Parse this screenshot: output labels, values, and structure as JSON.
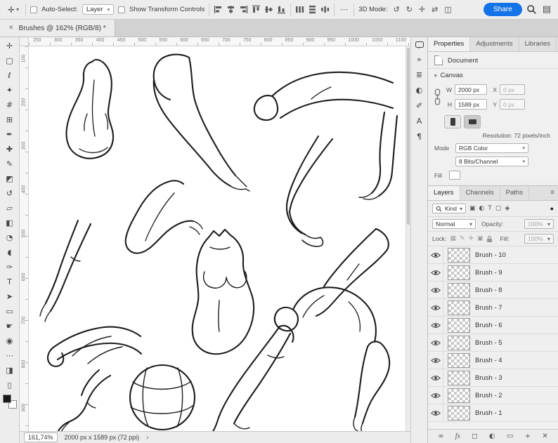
{
  "ui": {
    "chevron": "▾",
    "menu": "≡"
  },
  "topbar": {
    "tool_glyph": "✛",
    "auto_select_label": "Auto-Select:",
    "auto_select_value": "Layer",
    "transform_label": "Show Transform Controls",
    "more_glyph": "⋯",
    "threed_label": "3D Mode:",
    "threed_icons": [
      {
        "name": "3d-orbit-icon",
        "glyph": "↺"
      },
      {
        "name": "3d-roll-icon",
        "glyph": "↻"
      },
      {
        "name": "3d-drag-icon",
        "glyph": "✛"
      },
      {
        "name": "3d-slide-icon",
        "glyph": "⇄"
      },
      {
        "name": "3d-scale-icon",
        "glyph": "◫"
      }
    ],
    "share_label": "Share",
    "workspace_glyph": "▤"
  },
  "tab": {
    "close_glyph": "✕",
    "title": "Brushes @ 162% (RGB/8) *"
  },
  "tools": [
    {
      "name": "move-tool",
      "glyph": "✛"
    },
    {
      "name": "marquee-tool",
      "glyph": "▢"
    },
    {
      "name": "lasso-tool",
      "glyph": "ℓ"
    },
    {
      "name": "quick-selection-tool",
      "glyph": "✦"
    },
    {
      "name": "crop-tool",
      "glyph": "#"
    },
    {
      "name": "frame-tool",
      "glyph": "⊞"
    },
    {
      "name": "eyedropper-tool",
      "glyph": "✒"
    },
    {
      "name": "healing-brush-tool",
      "glyph": "✚"
    },
    {
      "name": "brush-tool",
      "glyph": "✎"
    },
    {
      "name": "clone-stamp-tool",
      "glyph": "◩"
    },
    {
      "name": "history-brush-tool",
      "glyph": "↺"
    },
    {
      "name": "eraser-tool",
      "glyph": "▱"
    },
    {
      "name": "gradient-tool",
      "glyph": "◧"
    },
    {
      "name": "blur-tool",
      "glyph": "◔"
    },
    {
      "name": "dodge-tool",
      "glyph": "◖"
    },
    {
      "name": "pen-tool",
      "glyph": "✑"
    },
    {
      "name": "type-tool",
      "glyph": "T"
    },
    {
      "name": "path-selection-tool",
      "glyph": "➤"
    },
    {
      "name": "shape-tool",
      "glyph": "▭"
    },
    {
      "name": "hand-tool",
      "glyph": "☛"
    },
    {
      "name": "zoom-tool",
      "glyph": "◉"
    }
  ],
  "tools_extra": [
    {
      "name": "edit-toolbar-icon",
      "glyph": "⋯"
    },
    {
      "name": "quick-mask-icon",
      "glyph": "◨"
    },
    {
      "name": "screen-mode-icon",
      "glyph": "▯"
    }
  ],
  "rulers": {
    "h": [
      "250",
      "300",
      "350",
      "400",
      "450",
      "500",
      "550",
      "600",
      "650",
      "700",
      "750",
      "800",
      "850",
      "900",
      "950",
      "1000",
      "1050",
      "1100"
    ],
    "v": [
      "100",
      "200",
      "300",
      "400",
      "500",
      "600",
      "700",
      "800",
      "900"
    ]
  },
  "strip_icons": [
    {
      "name": "expand-panels-icon",
      "glyph": "»"
    },
    {
      "name": "properties-strip-icon",
      "glyph": "≣"
    },
    {
      "name": "adjustments-strip-icon",
      "glyph": "◐"
    },
    {
      "name": "brush-settings-icon",
      "glyph": "✐"
    },
    {
      "name": "character-panel-icon",
      "glyph": "A"
    },
    {
      "name": "paragraph-panel-icon",
      "glyph": "¶"
    }
  ],
  "props": {
    "tabs": [
      {
        "name": "tab-properties",
        "label": "Properties"
      },
      {
        "name": "tab-adjustments",
        "label": "Adjustments"
      },
      {
        "name": "tab-libraries",
        "label": "Libraries"
      }
    ],
    "document_label": "Document",
    "canvas_header": "Canvas",
    "w_label": "W",
    "w_value": "2000 px",
    "x_label": "X",
    "x_value": "0 px",
    "h_label": "H",
    "h_value": "1589 px",
    "y_label": "Y",
    "y_value": "0 px",
    "resolution": "Resolution: 72 pixels/inch",
    "mode_label": "Mode",
    "mode_value": "RGB Color",
    "bits_value": "8 Bits/Channel",
    "fill_label": "Fill"
  },
  "layers": {
    "tabs": [
      {
        "name": "tab-layers",
        "label": "Layers"
      },
      {
        "name": "tab-channels",
        "label": "Channels"
      },
      {
        "name": "tab-paths",
        "label": "Paths"
      }
    ],
    "kind_label": "Kind",
    "filter_icons": [
      {
        "name": "filter-pixel-layers-icon",
        "glyph": "▣"
      },
      {
        "name": "filter-adjustment-layers-icon",
        "glyph": "◐"
      },
      {
        "name": "filter-type-layers-icon",
        "glyph": "T"
      },
      {
        "name": "filter-shape-layers-icon",
        "glyph": "▢"
      },
      {
        "name": "filter-smart-objects-icon",
        "glyph": "◈"
      }
    ],
    "filter_toggle_glyph": "●",
    "blend_mode": "Normal",
    "opacity_label": "Opacity:",
    "opacity_value": "100%",
    "lock_label": "Lock:",
    "lock_icons": [
      {
        "name": "lock-transparency-icon",
        "glyph": "▦"
      },
      {
        "name": "lock-pixels-icon",
        "glyph": "✎"
      },
      {
        "name": "lock-position-icon",
        "glyph": "✛"
      },
      {
        "name": "lock-artboard-icon",
        "glyph": "▣"
      }
    ],
    "fill_label": "Fill:",
    "fill_value": "100%",
    "items": [
      "Brush - 10",
      "Brush - 9",
      "Brush - 8",
      "Brush - 7",
      "Brush - 6",
      "Brush - 5",
      "Brush - 4",
      "Brush - 3",
      "Brush - 2",
      "Brush - 1"
    ],
    "bottom_icons": [
      {
        "name": "link-layers-icon",
        "glyph": "∞"
      },
      {
        "name": "layer-effects-icon",
        "glyph": "fx"
      },
      {
        "name": "add-mask-icon",
        "glyph": "◻"
      },
      {
        "name": "new-adjustment-icon",
        "glyph": "◐"
      },
      {
        "name": "new-group-icon",
        "glyph": "▭"
      },
      {
        "name": "new-layer-icon",
        "glyph": "+"
      },
      {
        "name": "delete-layer-icon",
        "glyph": "✕"
      }
    ]
  },
  "status": {
    "zoom": "161,74%",
    "doc_info": "2000 px x 1589 px (72 ppi)",
    "chevron": "›"
  },
  "colors": {
    "accent_blue": "#1473e6",
    "canvas_white": "#ffffff",
    "ui_gray": "#ededed"
  }
}
